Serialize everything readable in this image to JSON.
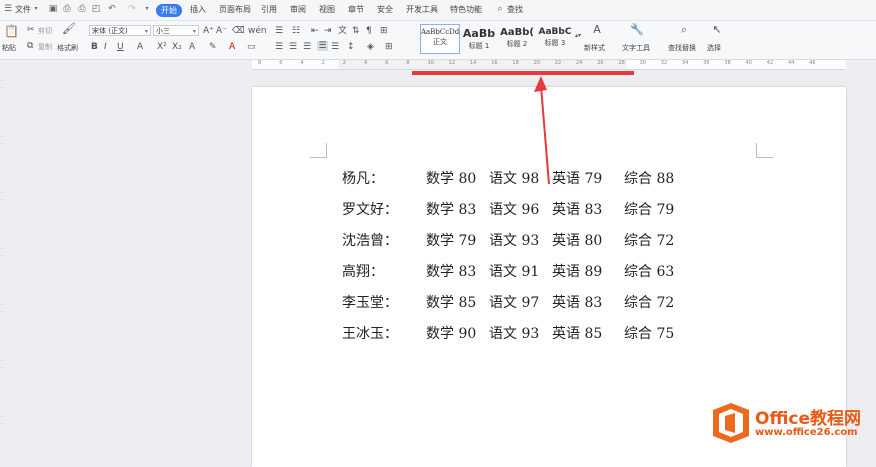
{
  "menubar": {
    "file": "文件",
    "tabs": [
      {
        "label": "开始",
        "active": true
      },
      {
        "label": "插入"
      },
      {
        "label": "页面布局"
      },
      {
        "label": "引用"
      },
      {
        "label": "审阅"
      },
      {
        "label": "视图"
      },
      {
        "label": "章节"
      },
      {
        "label": "安全"
      },
      {
        "label": "开发工具"
      },
      {
        "label": "特色功能"
      }
    ],
    "search": "查找"
  },
  "ribbon": {
    "paste": "粘贴",
    "cut": "剪切",
    "copy": "复制",
    "format_painter": "格式刷",
    "font_name": "宋体 (正文)",
    "font_size": "小三",
    "styles": [
      {
        "sample": "AaBbCcDd",
        "caption": "正文"
      },
      {
        "sample": "AaBb",
        "caption": "标题 1"
      },
      {
        "sample": "AaBb(",
        "caption": "标题 2"
      },
      {
        "sample": "AaBbC",
        "caption": "标题 3"
      }
    ],
    "new_style": "新样式",
    "text_tools": "文字工具",
    "find_replace": "查找替换",
    "select": "选择"
  },
  "ruler": {
    "ticks": [
      "8",
      "6",
      "4",
      "2",
      "2",
      "4",
      "6",
      "8",
      "10",
      "12",
      "14",
      "16",
      "18",
      "20",
      "22",
      "24",
      "26",
      "28",
      "30",
      "32",
      "34",
      "36",
      "38",
      "40",
      "42",
      "44",
      "46"
    ]
  },
  "document": {
    "rows": [
      {
        "name": "杨凡：",
        "math": "数学 80",
        "chinese": "语文 98",
        "english": "英语 79",
        "total": "综合 88"
      },
      {
        "name": "罗文好：",
        "math": "数学 83",
        "chinese": "语文 96",
        "english": "英语 83",
        "total": "综合 79"
      },
      {
        "name": "沈浩曾：",
        "math": "数学 79",
        "chinese": "语文 93",
        "english": "英语 80",
        "total": "综合 72"
      },
      {
        "name": "高翔：",
        "math": "数学 83",
        "chinese": "语文 91",
        "english": "英语 89",
        "total": "综合 63"
      },
      {
        "name": "李玉堂：",
        "math": "数学 85",
        "chinese": "语文 97",
        "english": "英语 83",
        "total": "综合 72"
      },
      {
        "name": "王冰玉：",
        "math": "数学 90",
        "chinese": "语文 93",
        "english": "英语 85",
        "total": "综合 75"
      }
    ]
  },
  "watermark": {
    "name": "Office教程网",
    "url": "www.office26.com"
  },
  "colors": {
    "accent": "#3a79f0",
    "annotation": "#e8383d",
    "brand": "#e85b16"
  }
}
